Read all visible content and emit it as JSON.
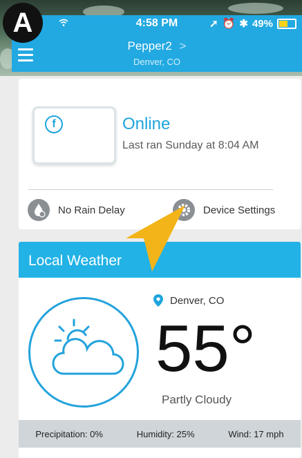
{
  "annotation": {
    "badge_label": "A"
  },
  "status_bar": {
    "time": "4:58 PM",
    "battery": "49%",
    "battery_level": 0.49
  },
  "header": {
    "device_name": "Pepper2",
    "chevron": ">",
    "location": "Denver, CO"
  },
  "status_card": {
    "status": "Online",
    "last_ran": "Last ran Sunday at 8:04 AM",
    "rain_delay_label": "No Rain Delay",
    "device_settings_label": "Device Settings"
  },
  "weather": {
    "title": "Local Weather",
    "location": "Denver, CO",
    "temperature": "55°",
    "condition": "Partly Cloudy",
    "precipitation": "Precipitation: 0%",
    "humidity": "Humidity: 25%",
    "wind": "Wind: 17 mph"
  },
  "colors": {
    "accent": "#22a9e2",
    "annotation_arrow": "#f2b418"
  }
}
